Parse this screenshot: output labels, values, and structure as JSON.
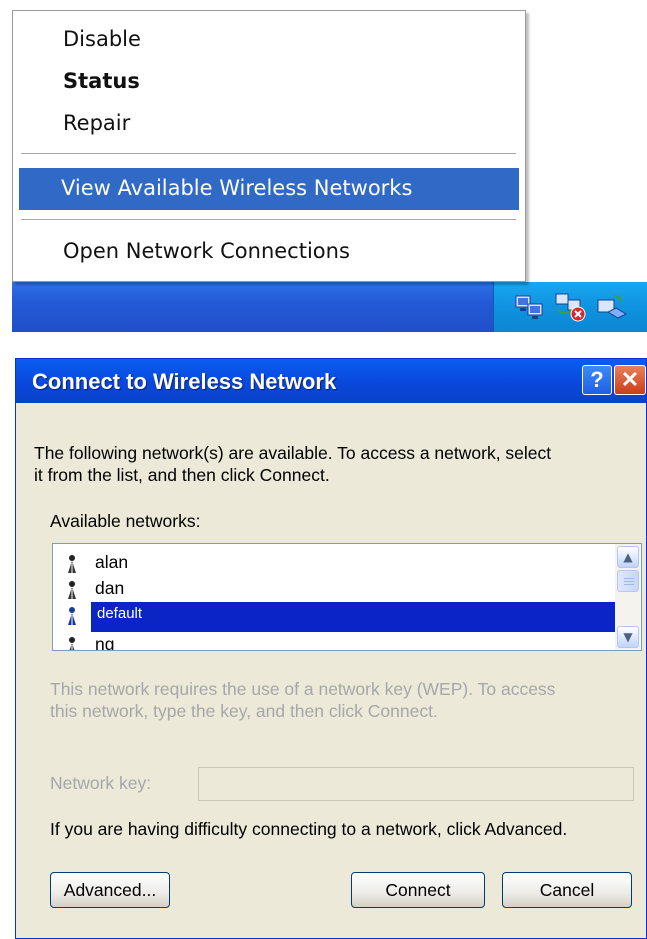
{
  "context_menu": {
    "items": [
      {
        "label": "Disable"
      },
      {
        "label": "Status"
      },
      {
        "label": "Repair"
      },
      {
        "label": "View Available Wireless Networks"
      },
      {
        "label": "Open Network Connections"
      }
    ]
  },
  "taskbar": {
    "tray_icons": [
      "network-connection-icon",
      "network-disconnected-icon",
      "wireless-network-icon"
    ]
  },
  "dialog": {
    "title": "Connect to Wireless Network",
    "help_label": "?",
    "close_label": "✕",
    "intro_text_line1": "The following network(s) are available. To access a network, select",
    "intro_text_line2": "it from the list, and then click Connect.",
    "available_label": "Available networks:",
    "networks": [
      {
        "name": "alan"
      },
      {
        "name": "dan"
      },
      {
        "name": "default",
        "selected": true
      },
      {
        "name": "ng"
      }
    ],
    "wep_text_line1": "This network requires the use of a network key (WEP). To access",
    "wep_text_line2": "this network, type the key, and then click Connect.",
    "network_key_label": "Network key:",
    "network_key_value": "",
    "advanced_text": "If you are having difficulty connecting to a network, click Advanced.",
    "buttons": {
      "advanced": "Advanced...",
      "connect": "Connect",
      "cancel": "Cancel"
    }
  },
  "colors": {
    "selection": "#0a24c6",
    "menu_highlight": "#3169c6",
    "titlebar": "#0a48dc",
    "dialog_bg": "#ece9d8",
    "taskbar": "#245ad6"
  }
}
